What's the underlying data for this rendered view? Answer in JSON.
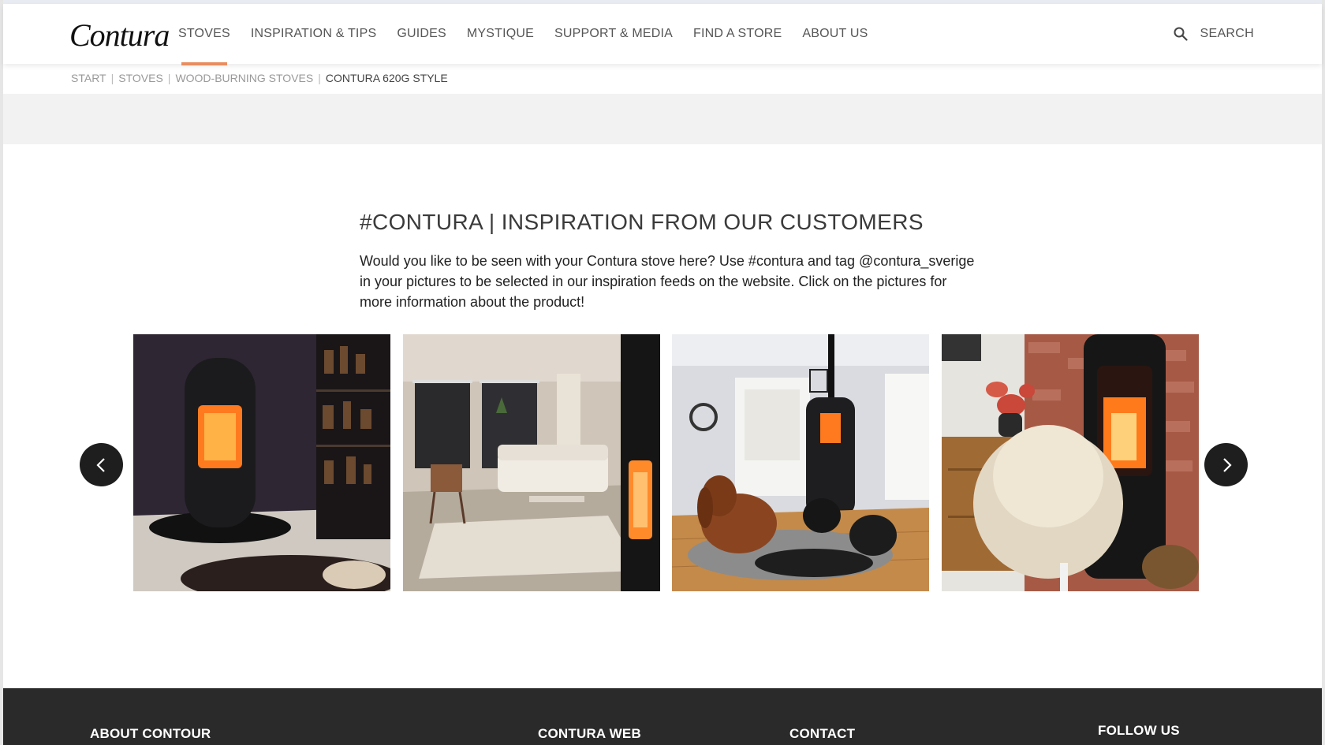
{
  "header": {
    "logo": "Contura",
    "nav": [
      "STOVES",
      "INSPIRATION & TIPS",
      "GUIDES",
      "MYSTIQUE",
      "SUPPORT & MEDIA",
      "FIND A STORE",
      "ABOUT US"
    ],
    "search_label": "SEARCH",
    "accent_color": "#e98d5f"
  },
  "breadcrumb": [
    "START",
    "STOVES",
    "WOOD-BURNING STOVES",
    "CONTURA 620G STYLE"
  ],
  "inspiration": {
    "heading": "#CONTURA | INSPIRATION FROM OUR CUSTOMERS",
    "intro": "Would you like to be seen with your Contura stove here? Use #contura and tag @contura_sverige in your pictures to be selected in our inspiration feeds on the website. Click on the pictures for more information about the product!"
  },
  "carousel": {
    "photos": [
      "stove-dark-room",
      "living-room-stove",
      "dogs-by-stove",
      "sheepskin-chair-stove"
    ],
    "prev_icon": "chevron-left-icon",
    "next_icon": "chevron-right-icon"
  },
  "footer": {
    "columns": [
      "ABOUT CONTOUR",
      "CONTURA WEB",
      "CONTACT",
      "FOLLOW US"
    ]
  }
}
